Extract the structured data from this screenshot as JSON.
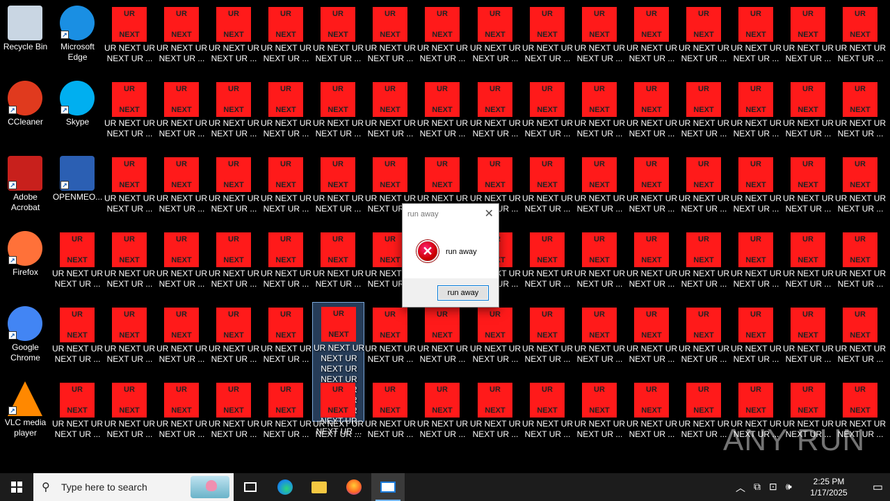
{
  "desktop": {
    "system_icons": [
      {
        "label": "Recycle Bin",
        "icon": "recycle-bin-icon",
        "color": "#c9d6e3"
      },
      {
        "label": "Microsoft Edge",
        "icon": "edge-icon",
        "color": "#1a8fe3"
      },
      {
        "label": "CCleaner",
        "icon": "ccleaner-icon",
        "color": "#e03a1e"
      },
      {
        "label": "Skype",
        "icon": "skype-icon",
        "color": "#00aff0"
      },
      {
        "label": "Adobe Acrobat",
        "icon": "acrobat-icon",
        "color": "#c8201c"
      },
      {
        "label": "OPENMEO...",
        "icon": "word-document-icon",
        "color": "#2b5fb3"
      },
      {
        "label": "Firefox",
        "icon": "firefox-icon",
        "color": "#ff7139"
      },
      {
        "label": "Google Chrome",
        "icon": "chrome-icon",
        "color": "#4285f4"
      },
      {
        "label": "VLC media player",
        "icon": "vlc-icon",
        "color": "#ff8800"
      }
    ],
    "ur_tile": {
      "top_text": "UR",
      "bottom_text": "NEXT",
      "label": "UR NEXT UR NEXT UR ...",
      "selected_label": "UR NEXT UR NEXT UR NEXT UR NEXT UR NEXT UR NEXT UR NEXT UR NEXT UR NEXT UR ...",
      "color": "#ff1a1a"
    }
  },
  "dialog": {
    "title": "run away",
    "message": "run away",
    "button": "run away"
  },
  "watermark": "ANY RUN",
  "taskbar": {
    "search_placeholder": "Type here to search",
    "time": "2:25 PM",
    "date": "1/17/2025"
  }
}
